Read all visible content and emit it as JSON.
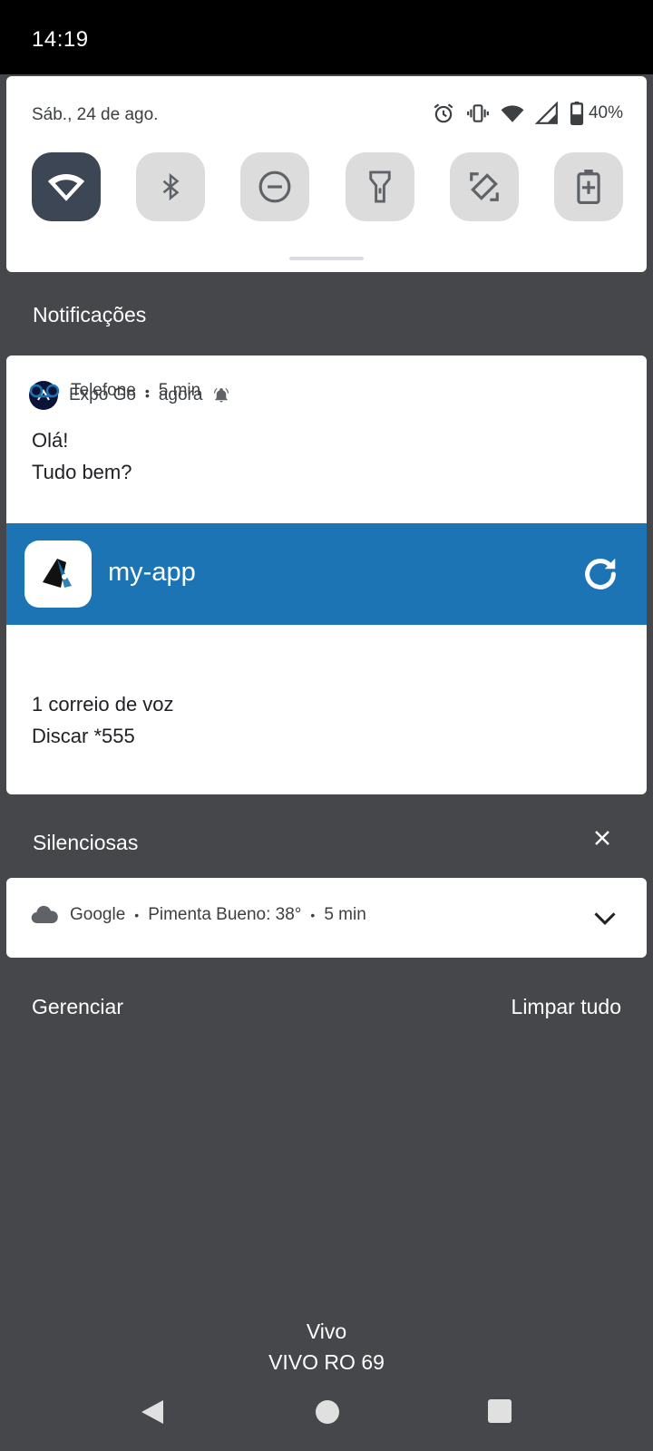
{
  "status_bar": {
    "time": "14:19"
  },
  "quick_settings": {
    "date": "Sáb., 24 de ago.",
    "battery_percent": "40%",
    "status_icons": [
      "alarm-icon",
      "vibrate-icon",
      "wifi-icon",
      "cellular-signal-icon",
      "battery-icon"
    ],
    "tiles": [
      {
        "name": "wifi",
        "icon": "wifi-icon",
        "active": true
      },
      {
        "name": "bluetooth",
        "icon": "bluetooth-icon",
        "active": false
      },
      {
        "name": "do-not-disturb",
        "icon": "do-not-disturb-icon",
        "active": false
      },
      {
        "name": "flashlight",
        "icon": "flashlight-icon",
        "active": false
      },
      {
        "name": "auto-rotate",
        "icon": "auto-rotate-icon",
        "active": false
      },
      {
        "name": "battery-saver",
        "icon": "battery-saver-icon",
        "active": false
      }
    ]
  },
  "notifications": {
    "section_title": "Notificações",
    "expo": {
      "app_name": "Expo Go",
      "time": "agora",
      "line1": "Olá!",
      "line2": "Tudo bem?",
      "banner_app": "my-app",
      "banner_color": "#1c74b4"
    },
    "phone": {
      "app_name": "Telefone",
      "time": "5 min",
      "line1": "1 correio de voz",
      "line2": "Discar *555"
    }
  },
  "silent": {
    "section_title": "Silenciosas",
    "google": {
      "app_name": "Google",
      "summary": "Pimenta Bueno: 38°",
      "time": "5 min"
    }
  },
  "footer": {
    "manage": "Gerenciar",
    "clear_all": "Limpar tudo"
  },
  "carrier": {
    "line1": "Vivo",
    "line2": "VIVO RO 69"
  }
}
